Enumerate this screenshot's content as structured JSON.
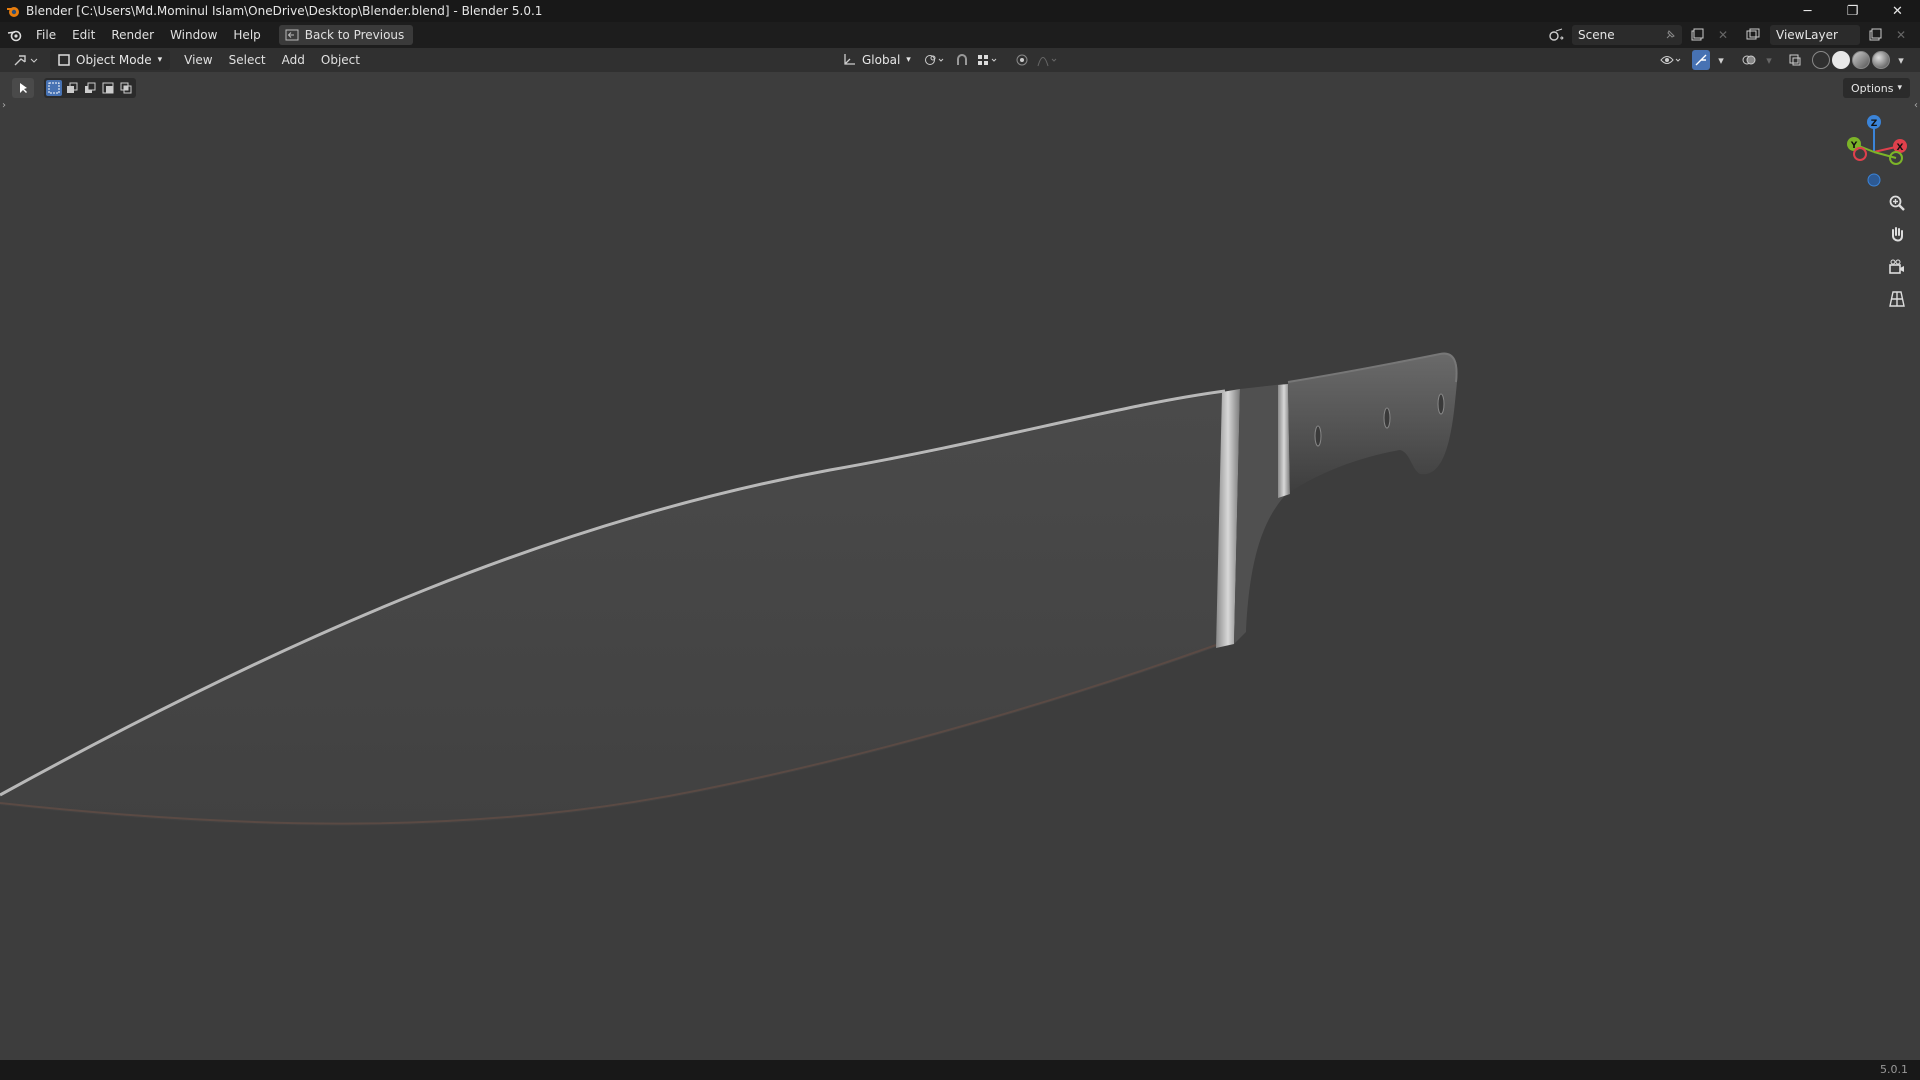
{
  "window": {
    "title": "Blender [C:\\Users\\Md.Mominul Islam\\OneDrive\\Desktop\\Blender.blend] - Blender 5.0.1",
    "minimize_glyph": "─",
    "maximize_glyph": "❐",
    "close_glyph": "✕"
  },
  "topbar": {
    "menus": [
      "File",
      "Edit",
      "Render",
      "Window",
      "Help"
    ],
    "back_button_label": "Back to Previous",
    "scene_label": "Scene",
    "viewlayer_label": "ViewLayer"
  },
  "viewport_header": {
    "mode_label": "Object Mode",
    "menus": [
      "View",
      "Select",
      "Add",
      "Object"
    ],
    "transform_orientation": "Global"
  },
  "viewport": {
    "options_label": "Options",
    "gizmo_axes": {
      "z": "Z",
      "y": "Y",
      "x": "X"
    },
    "colors": {
      "x_axis": "#e0404c",
      "y_axis": "#7cb428",
      "z_axis": "#3b84d8",
      "accent": "#4772b3"
    }
  },
  "statusbar": {
    "version": "5.0.1"
  }
}
